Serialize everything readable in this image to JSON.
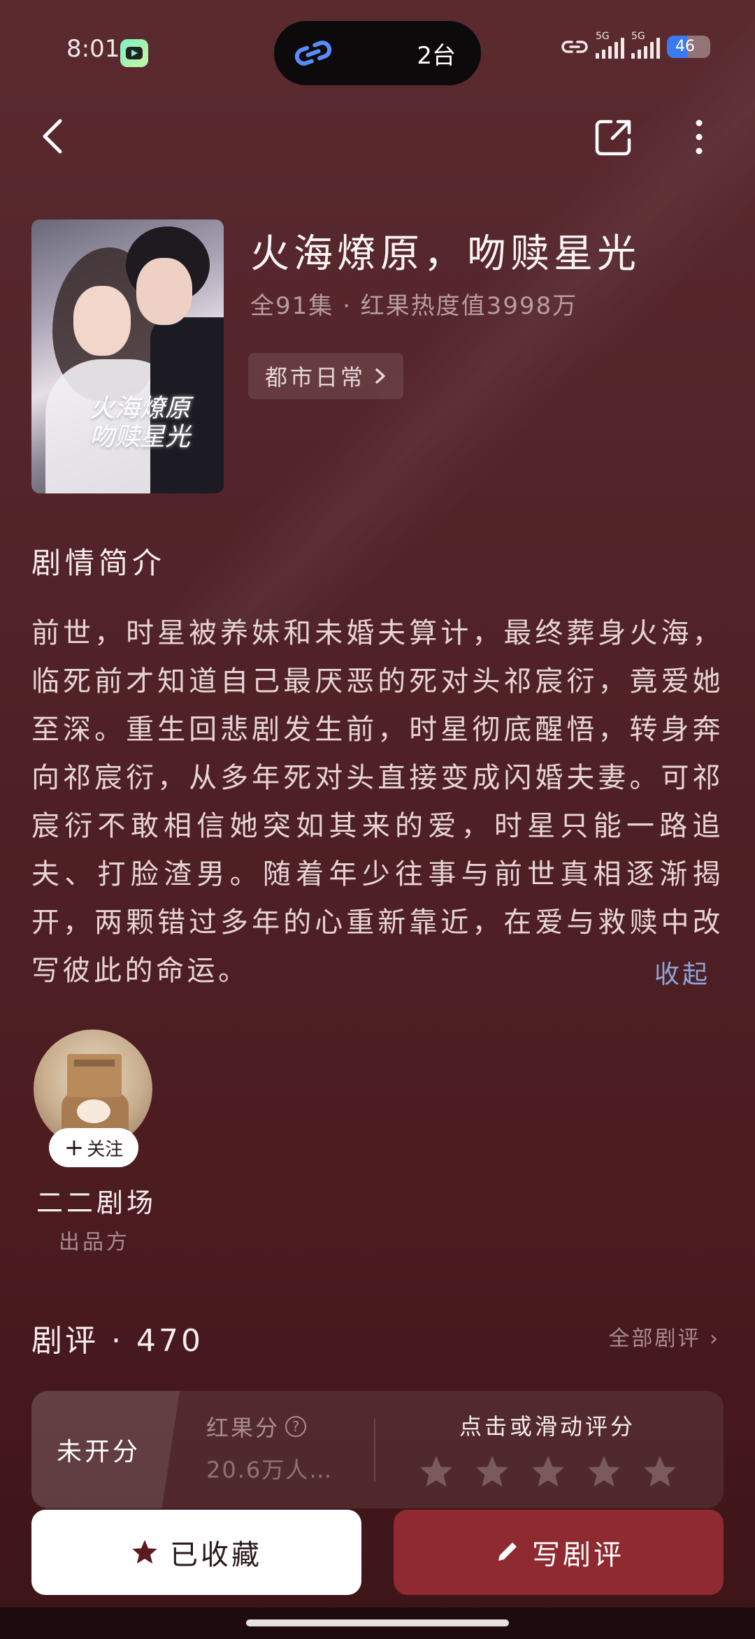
{
  "status_bar": {
    "time": "8:01",
    "island_text": "2台",
    "network_1": "5G",
    "network_2": "5G",
    "battery_level": "46"
  },
  "drama": {
    "title": "火海燎原，吻赎星光",
    "meta": "全91集 · 红果热度值3998万",
    "genre": "都市日常",
    "cover_title_line1": "火海燎原",
    "cover_title_line2": "吻赎星光"
  },
  "synopsis": {
    "heading": "剧情简介",
    "text": "前世，时星被养妹和未婚夫算计，最终葬身火海，临死前才知道自己最厌恶的死对头祁宸衍，竟爱她至深。重生回悲剧发生前，时星彻底醒悟，转身奔向祁宸衍，从多年死对头直接变成闪婚夫妻。可祁宸衍不敢相信她突如其来的爱，时星只能一路追夫、打脸渣男。随着年少往事与前世真相逐渐揭开，两颗错过多年的心重新靠近，在爱与救赎中改写彼此的命运。",
    "collapse_label": "收起"
  },
  "producer": {
    "follow_label": "关注",
    "name": "二二剧场",
    "role": "出品方"
  },
  "reviews": {
    "heading": "剧评 · 470",
    "all_label": "全部剧评",
    "unrated_label": "未开分",
    "score_label": "红果分",
    "score_count": "20.6万人…",
    "rate_prompt": "点击或滑动评分"
  },
  "actions": {
    "collect_label": "已收藏",
    "review_label": "写剧评"
  },
  "colors": {
    "background": "#4f2126",
    "accent_button": "#8e2a30",
    "link": "#8fa6d8"
  }
}
